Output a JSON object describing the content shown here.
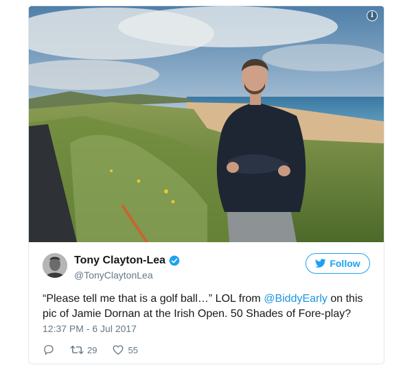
{
  "photo": {
    "info_icon_glyph": "i"
  },
  "author": {
    "name": "Tony Clayton-Lea",
    "handle": "@TonyClaytonLea",
    "verified": true
  },
  "follow_button": {
    "label": "Follow"
  },
  "tweet": {
    "text_part1": "“Please tell me that is a golf ball…” LOL from ",
    "mention": "@BiddyEarly",
    "text_part2": " on this pic of Jamie Dornan at the Irish Open. 50 Shades of Fore-play?",
    "timestamp": "12:37 PM - 6 Jul 2017"
  },
  "actions": {
    "reply_icon": "reply-icon",
    "retweet_icon": "retweet-icon",
    "retweet_count": "29",
    "like_icon": "heart-icon",
    "like_count": "55"
  },
  "colors": {
    "accent": "#1da1f2",
    "link": "#1b95e0",
    "muted": "#657786",
    "text": "#14171a"
  }
}
